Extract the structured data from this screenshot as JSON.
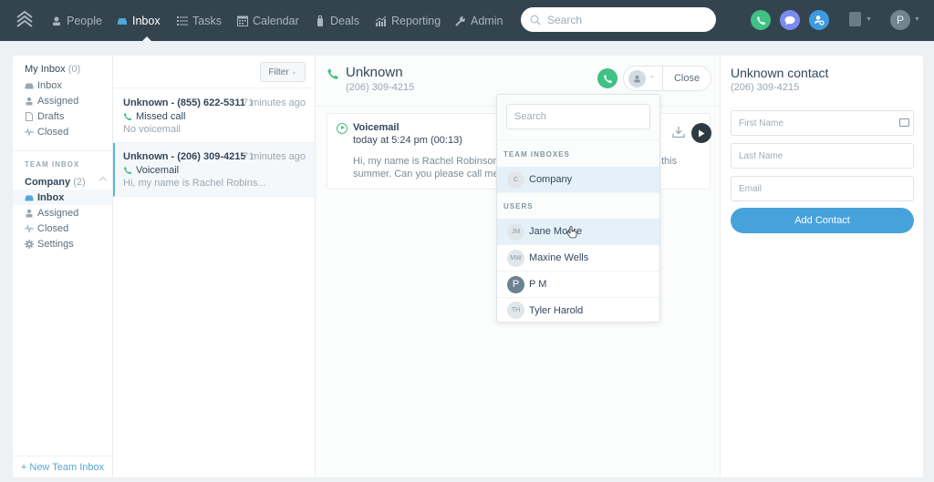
{
  "nav": {
    "items": [
      {
        "label": "People",
        "icon": "people-icon",
        "active": false
      },
      {
        "label": "Inbox",
        "icon": "inbox-icon",
        "active": true
      },
      {
        "label": "Tasks",
        "icon": "tasks-icon",
        "active": false
      },
      {
        "label": "Calendar",
        "icon": "calendar-icon",
        "active": false
      },
      {
        "label": "Deals",
        "icon": "deals-icon",
        "active": false
      },
      {
        "label": "Reporting",
        "icon": "reporting-icon",
        "active": false
      },
      {
        "label": "Admin",
        "icon": "wrench-icon",
        "active": false
      }
    ],
    "search_placeholder": "Search",
    "avatar_initial": "P"
  },
  "colors": {
    "nav_bg": "#33444f",
    "green": "#3fc283",
    "purple": "#7b8cf0",
    "blue": "#3f9be0",
    "accent": "#47a2dc"
  },
  "sidebar": {
    "my_inbox": {
      "label": "My Inbox",
      "count": "(0)"
    },
    "my_items": [
      {
        "label": "Inbox",
        "icon": "inbox-icon"
      },
      {
        "label": "Assigned",
        "icon": "person-icon"
      },
      {
        "label": "Drafts",
        "icon": "draft-icon"
      },
      {
        "label": "Closed",
        "icon": "pulse-icon"
      }
    ],
    "section_label": "TEAM INBOX",
    "team": {
      "label": "Company",
      "count": "(2)"
    },
    "team_items": [
      {
        "label": "Inbox",
        "icon": "inbox-icon",
        "active": true
      },
      {
        "label": "Assigned",
        "icon": "person-icon"
      },
      {
        "label": "Closed",
        "icon": "pulse-icon"
      },
      {
        "label": "Settings",
        "icon": "gear-icon"
      }
    ],
    "footer": "+ New Team Inbox"
  },
  "list": {
    "filter_label": "Filter",
    "conversations": [
      {
        "title": "Unknown - (855) 622-5311",
        "count": "1",
        "time": "7 minutes ago",
        "type": "Missed call",
        "sub": "No voicemail",
        "selected": false
      },
      {
        "title": "Unknown - (206) 309-4215",
        "count": "1",
        "time": "7 minutes ago",
        "type": "Voicemail",
        "sub": "Hi, my name is Rachel Robins...",
        "selected": true
      }
    ]
  },
  "main": {
    "title": "Unknown",
    "phone": "(206) 309-4215",
    "close_label": "Close",
    "voicemail": {
      "title": "Voicemail",
      "date": "today at 5:24 pm (00:13)",
      "text_line1_visible": "Hi, my name is Rachel Robinson, and",
      "text_line1_end": "this",
      "text_line2_visible": "summer. Can you please call me back"
    }
  },
  "dropdown": {
    "search_placeholder": "Search",
    "team_section": "TEAM INBOXES",
    "teams": [
      {
        "initials": "C",
        "name": "Company"
      }
    ],
    "users_section": "USERS",
    "users": [
      {
        "initials": "JM",
        "name": "Jane Moore",
        "highlighted": true
      },
      {
        "initials": "MW",
        "name": "Maxine Wells"
      },
      {
        "initials": "P",
        "name": "P M",
        "dark": true
      },
      {
        "initials": "TH",
        "name": "Tyler Harold"
      }
    ]
  },
  "contact": {
    "title": "Unknown contact",
    "phone": "(206) 309-4215",
    "first_name_placeholder": "First Name",
    "last_name_placeholder": "Last Name",
    "email_placeholder": "Email",
    "add_label": "Add Contact"
  }
}
